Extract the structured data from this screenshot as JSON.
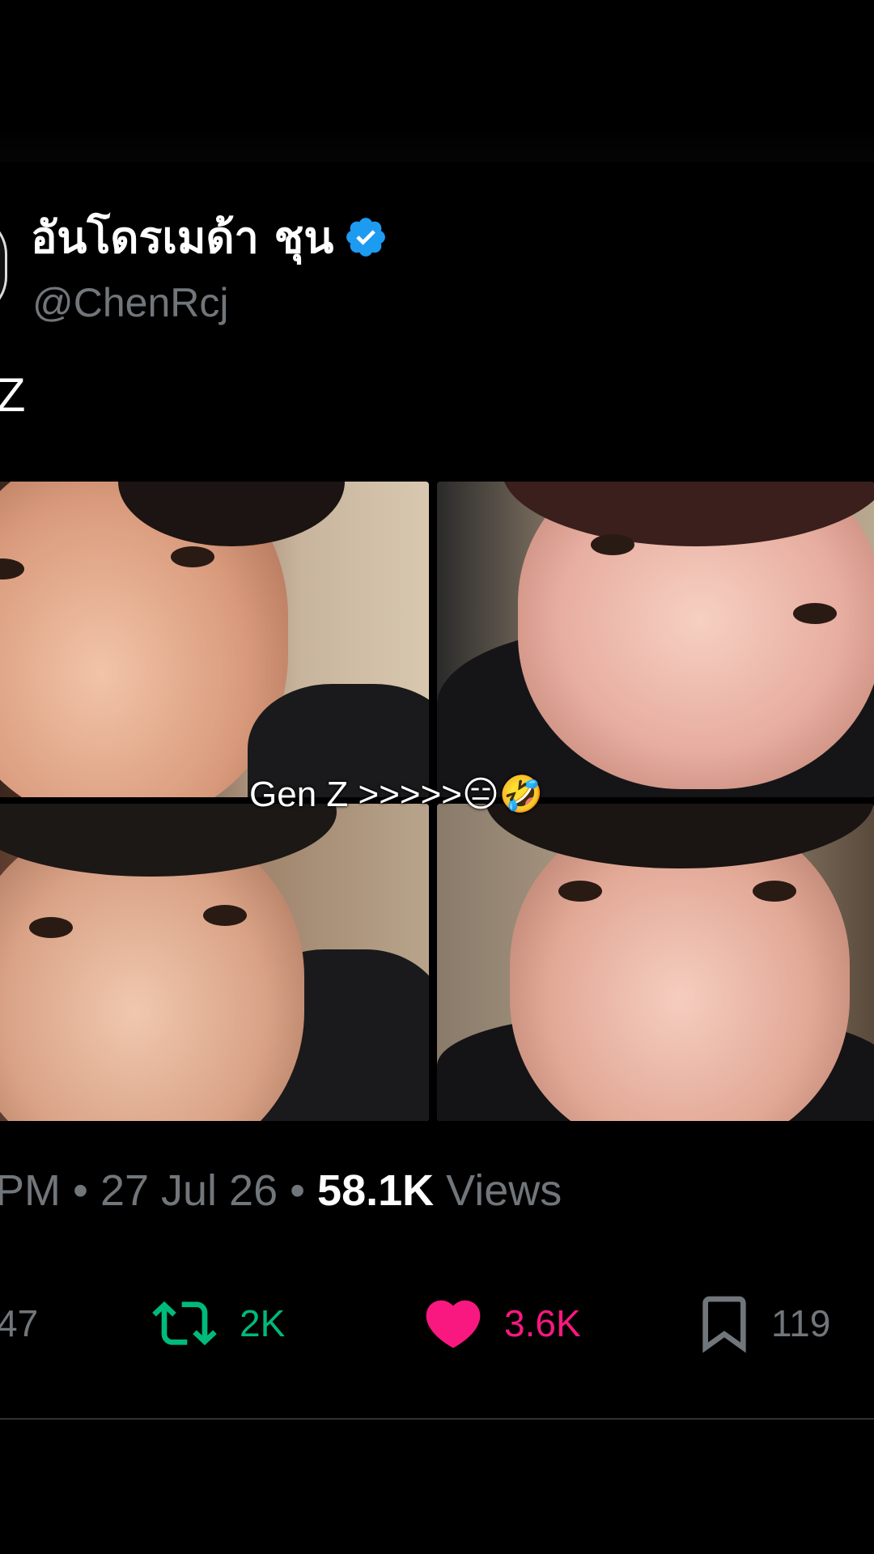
{
  "tweet": {
    "display_name": "อันโดรเมด้า ชุน",
    "handle": "@ChenRcj",
    "text": "Z",
    "caption_overlay": "Gen Z >>>>>😑🤣",
    "meta": {
      "time": "PM",
      "separator": "•",
      "date": "27 Jul 26",
      "views_count": "58.1K",
      "views_label": "Views"
    },
    "actions": {
      "replies": "47",
      "reposts": "2K",
      "likes": "3.6K",
      "bookmarks": "119"
    }
  },
  "colors": {
    "background": "#000000",
    "verified_blue": "#1d9bf0",
    "repost_green": "#00ba7c",
    "like_pink": "#f91880",
    "muted_text": "#71767b"
  },
  "icons": [
    "verified-badge-icon",
    "repost-icon",
    "heart-icon",
    "bookmark-icon"
  ]
}
